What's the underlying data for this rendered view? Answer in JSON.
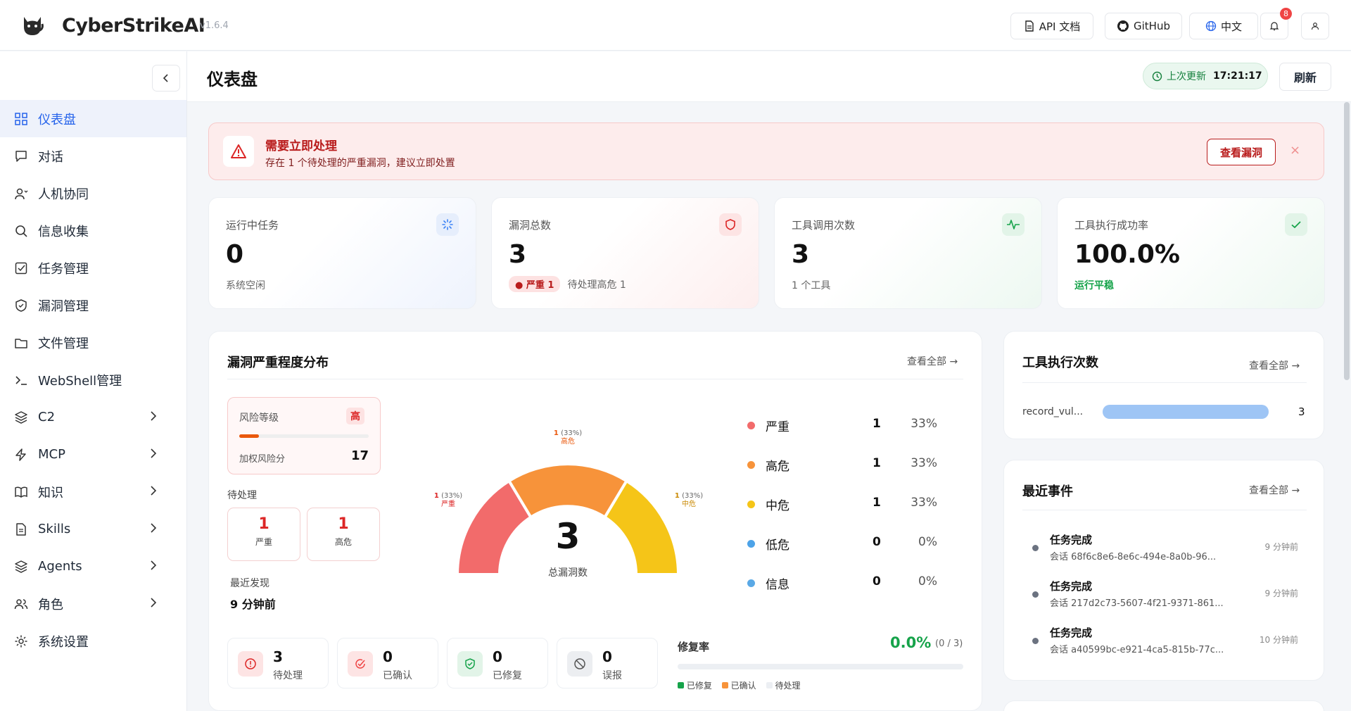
{
  "app": {
    "brand": "CyberStrikeAI",
    "version": "v1.6.4"
  },
  "topbar": {
    "api_docs": "API 文档",
    "github": "GitHub",
    "language": "中文",
    "notification_count": "8"
  },
  "sidebar": {
    "items": [
      {
        "label": "仪表盘",
        "icon": "dashboard-icon",
        "active": true
      },
      {
        "label": "对话",
        "icon": "chat-icon"
      },
      {
        "label": "人机协同",
        "icon": "user-collab-icon"
      },
      {
        "label": "信息收集",
        "icon": "search-icon"
      },
      {
        "label": "任务管理",
        "icon": "task-check-icon"
      },
      {
        "label": "漏洞管理",
        "icon": "shield-icon"
      },
      {
        "label": "文件管理",
        "icon": "folder-icon"
      },
      {
        "label": "WebShell管理",
        "icon": "terminal-icon"
      },
      {
        "label": "C2",
        "icon": "layers-icon",
        "expandable": true
      },
      {
        "label": "MCP",
        "icon": "bolt-icon",
        "expandable": true
      },
      {
        "label": "知识",
        "icon": "book-icon",
        "expandable": true
      },
      {
        "label": "Skills",
        "icon": "document-icon",
        "expandable": true
      },
      {
        "label": "Agents",
        "icon": "layers-icon",
        "expandable": true
      },
      {
        "label": "角色",
        "icon": "users-icon",
        "expandable": true
      },
      {
        "label": "系统设置",
        "icon": "gear-icon"
      }
    ]
  },
  "header": {
    "title": "仪表盘",
    "last_updated_label": "上次更新",
    "last_updated_time": "17:21:17",
    "refresh": "刷新"
  },
  "alert": {
    "title": "需要立即处理",
    "message": "存在 1 个待处理的严重漏洞，建议立即处置",
    "action": "查看漏洞",
    "close": "×"
  },
  "stats": [
    {
      "label": "运行中任务",
      "value": "0",
      "sub": "系统空闲"
    },
    {
      "label": "漏洞总数",
      "value": "3",
      "pill": "严重 1",
      "sub": "待处理高危 1"
    },
    {
      "label": "工具调用次数",
      "value": "3",
      "sub": "1 个工具"
    },
    {
      "label": "工具执行成功率",
      "value": "100.0%",
      "sub": "运行平稳"
    }
  ],
  "severity": {
    "title": "漏洞严重程度分布",
    "view_all": "查看全部 →",
    "risk_label": "风险等级",
    "risk_level": "高",
    "risk_fill": 0.15,
    "weighted_label": "加权风险分",
    "weighted_score": "17",
    "pending_label": "待处理",
    "pending": [
      {
        "value": "1",
        "label": "严重"
      },
      {
        "value": "1",
        "label": "高危"
      }
    ],
    "recent_label": "最近发现",
    "recent_value": "9 分钟前",
    "total": "3",
    "total_label": "总漏洞数",
    "gauge_labels": [
      {
        "count": "1",
        "pct": "(33%)",
        "name": "严重"
      },
      {
        "count": "1",
        "pct": "(33%)",
        "name": "高危"
      },
      {
        "count": "1",
        "pct": "(33%)",
        "name": "中危"
      }
    ],
    "legend": [
      {
        "name": "严重",
        "count": "1",
        "pct": "33%",
        "color": "#f26b6b"
      },
      {
        "name": "高危",
        "count": "1",
        "pct": "33%",
        "color": "#f7933a"
      },
      {
        "name": "中危",
        "count": "1",
        "pct": "33%",
        "color": "#f5c518"
      },
      {
        "name": "低危",
        "count": "0",
        "pct": "0%",
        "color": "#4da3e8"
      },
      {
        "name": "信息",
        "count": "0",
        "pct": "0%",
        "color": "#5aa9e6"
      }
    ],
    "status": [
      {
        "value": "3",
        "label": "待处理"
      },
      {
        "value": "0",
        "label": "已确认"
      },
      {
        "value": "0",
        "label": "已修复"
      },
      {
        "value": "0",
        "label": "误报"
      }
    ],
    "fix_rate_label": "修复率",
    "fix_rate": "0.0%",
    "fix_ratio": "(0 / 3)",
    "fix_legend": [
      "已修复",
      "已确认",
      "待处理"
    ]
  },
  "tools": {
    "title": "工具执行次数",
    "view_all": "查看全部 →",
    "rows": [
      {
        "name": "record_vul...",
        "count": "3",
        "fill": 1.0
      }
    ]
  },
  "events": {
    "title": "最近事件",
    "view_all": "查看全部 →",
    "items": [
      {
        "title": "任务完成",
        "sub": "会话 68f6c8e6-8e6c-494e-8a0b-96...",
        "time": "9 分钟前"
      },
      {
        "title": "任务完成",
        "sub": "会话 217d2c73-5607-4f21-9371-861...",
        "time": "9 分钟前"
      },
      {
        "title": "任务完成",
        "sub": "会话 a40599bc-e921-4ca5-815b-77c...",
        "time": "10 分钟前"
      }
    ]
  }
}
